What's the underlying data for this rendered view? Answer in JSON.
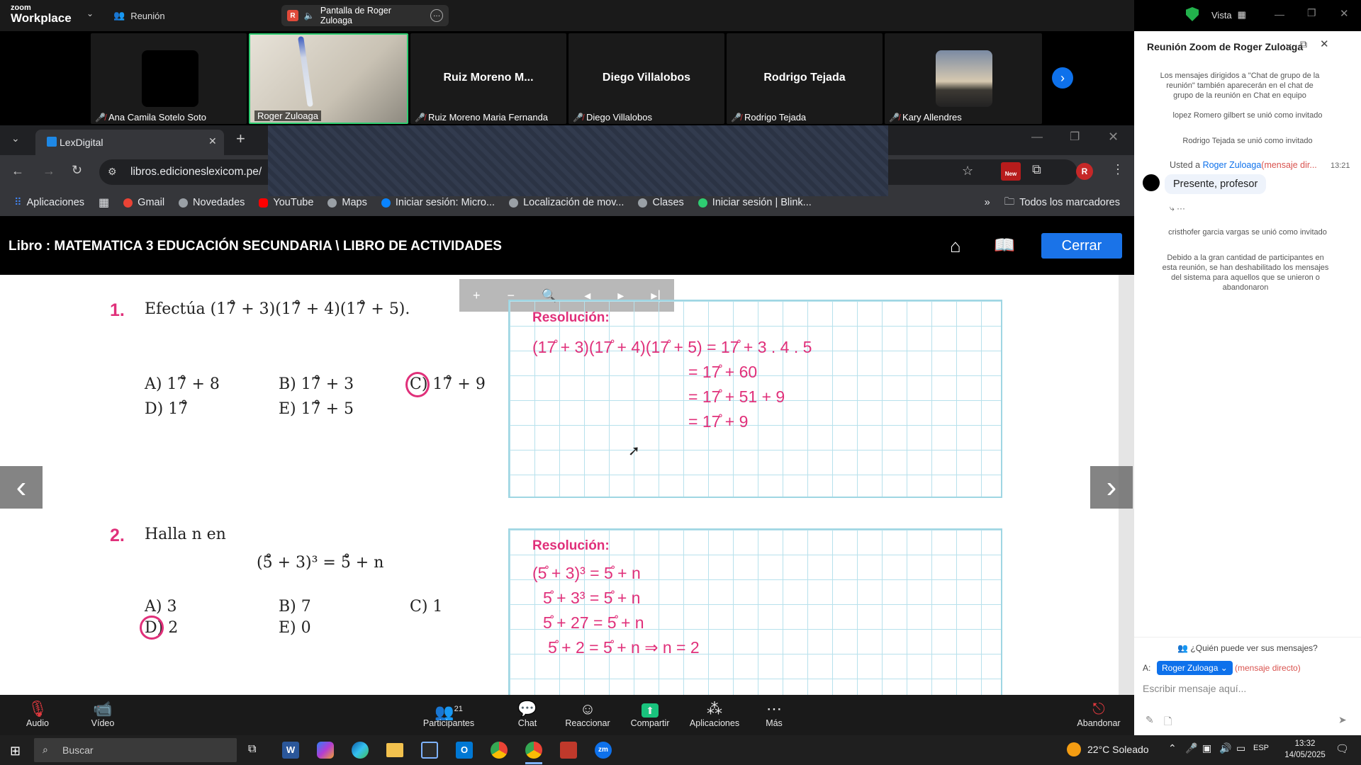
{
  "zoom": {
    "brand_small": "zoom",
    "brand_big": "Workplace",
    "meeting_label": "Reunión",
    "share_label": "Pantalla de Roger Zuloaga",
    "share_badge": "R",
    "view_label": "Vista"
  },
  "gallery": [
    {
      "name": "Ana Camila Sotelo Soto",
      "big": ""
    },
    {
      "name": "Roger Zuloaga",
      "big": ""
    },
    {
      "name": "Ruiz Moreno Maria Fernanda",
      "big": "Ruiz  Moreno  M..."
    },
    {
      "name": "Diego Villalobos",
      "big": "Diego Villalobos"
    },
    {
      "name": "Rodrigo Tejada",
      "big": "Rodrigo Tejada"
    },
    {
      "name": "Kary Allendres",
      "big": ""
    }
  ],
  "browser": {
    "tab_title": "LexDigital",
    "url": "libros.edicioneslexicom.pe/",
    "new_badge": "New",
    "profile_initial": "R"
  },
  "bookmarks": [
    {
      "label": "Aplicaciones",
      "color": "#4285f4"
    },
    {
      "label": "Gmail",
      "color": "#ea4335"
    },
    {
      "label": "Novedades",
      "color": "#bbb"
    },
    {
      "label": "YouTube",
      "color": "#ff0000"
    },
    {
      "label": "Maps",
      "color": "#bbb"
    },
    {
      "label": "Iniciar sesión: Micro...",
      "color": "#0a84ff"
    },
    {
      "label": "Localización de mov...",
      "color": "#bbb"
    },
    {
      "label": "Clases",
      "color": "#bbb"
    },
    {
      "label": "Iniciar sesión | Blink...",
      "color": "#2ecc71"
    }
  ],
  "bookmarks_all": "Todos los marcadores",
  "lex": {
    "title": "Libro : MATEMATICA 3 EDUCACIÓN SECUNDARIA \\ LIBRO DE ACTIVIDADES",
    "close": "Cerrar"
  },
  "problem1": {
    "num": "1.",
    "statement": "Efectúa (17̊ + 3)(17̊ + 4)(17̊ + 5).",
    "options": [
      "A) 17̊ + 8",
      "B) 17̊ + 3",
      "C) 17̊ + 9",
      "D) 17̊",
      "E) 17̊ + 5"
    ],
    "res_title": "Resolución:",
    "steps": [
      "(17̊ + 3)(17̊ + 4)(17̊ + 5) = 17̊ + 3 . 4 . 5",
      "= 17̊ + 60",
      "= 17̊ + 51 + 9",
      "= 17̊ + 9"
    ]
  },
  "problem2": {
    "num": "2.",
    "statement": "Halla n en",
    "equation": "(5̊ + 3)³ = 5̊ + n",
    "options": [
      "A) 3",
      "B) 7",
      "C) 1",
      "D) 2",
      "E) 0"
    ],
    "res_title": "Resolución:",
    "steps": [
      "(5̊ + 3)³ = 5̊ + n",
      "5̊ + 3³ = 5̊ + n",
      "5̊ + 27 = 5̊ + n",
      "5̊ + 2 = 5̊ + n ⇒ n = 2"
    ]
  },
  "chat": {
    "title": "Reunión Zoom de Roger Zuloaga",
    "notice": "Los mensajes dirigidos a \"Chat de grupo de la reunión\" también aparecerán en el chat de grupo de la reunión en Chat en equipo",
    "join1": "lopez Romero gilbert se unió como invitado",
    "join2": "Rodrigo Tejada se unió como invitado",
    "msg_from": "Usted a",
    "msg_to": "Roger Zuloaga",
    "msg_dm": "(mensaje dir...",
    "msg_time": "13:21",
    "msg_text": "Presente, profesor",
    "join3": "cristhofer garcia vargas se unió como invitado",
    "sys": "Debido a la gran cantidad de participantes en esta reunión, se han deshabilitado los mensajes del sistema para aquellos que se unieron o abandonaron",
    "who": "¿Quién puede ver sus mensajes?",
    "to_label": "A:",
    "to_value": "Roger Zuloaga",
    "to_dm": "(mensaje directo)",
    "placeholder": "Escribir mensaje aquí..."
  },
  "toolbar": {
    "audio": "Audio",
    "video": "Vídeo",
    "participants": "Participantes",
    "participants_count": "21",
    "chat": "Chat",
    "react": "Reaccionar",
    "share": "Compartir",
    "apps": "Aplicaciones",
    "more": "Más",
    "leave": "Abandonar"
  },
  "taskbar": {
    "search": "Buscar",
    "weather": "22°C  Soleado",
    "lang": "ESP",
    "time": "13:32",
    "date": "14/05/2025"
  }
}
